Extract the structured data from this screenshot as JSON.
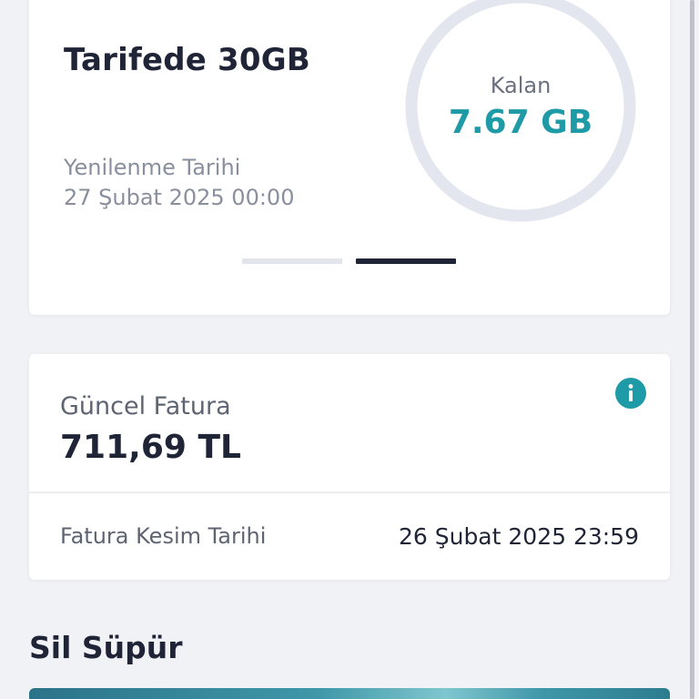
{
  "usage": {
    "plan_title": "Tarifede 30GB",
    "renewal_label": "Yenilenme Tarihi",
    "renewal_date": "27 Şubat 2025 00:00",
    "remaining_label": "Kalan",
    "remaining_value": "7.67 GB",
    "remaining_fraction": 0.2557,
    "colors": {
      "arc": "#1f9aa7",
      "track": "#e3e6ee"
    },
    "pager": {
      "page_count": 2,
      "active_page": 2
    }
  },
  "bill": {
    "current_label": "Güncel Fatura",
    "current_amount": "711,69 TL",
    "info_icon": "info-icon",
    "cutoff_label": "Fatura Kesim Tarihi",
    "cutoff_date": "26 Şubat 2025 23:59",
    "colors": {
      "info": "#1f9aa7"
    }
  },
  "promo": {
    "section_title": "Sil Süpür"
  }
}
